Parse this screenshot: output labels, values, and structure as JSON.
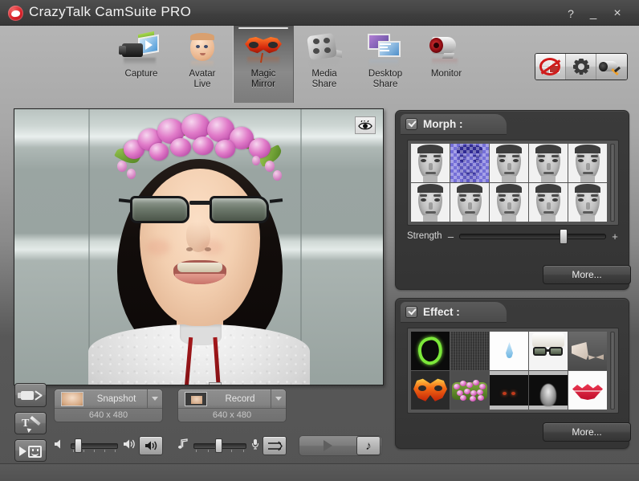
{
  "window": {
    "title": "CrazyTalk CamSuite PRO",
    "logo_icon": "crazytalk-lips-logo",
    "help_label": "?",
    "minimize_label": "_",
    "close_label": "×"
  },
  "toolbar": {
    "items": [
      {
        "label": "Capture",
        "icon": "camera-capture-icon",
        "active": false
      },
      {
        "label": "Avatar\nLive",
        "icon": "avatar-face-icon",
        "active": false
      },
      {
        "label": "Magic\nMirror",
        "icon": "carnival-mask-icon",
        "active": true
      },
      {
        "label": "Media\nShare",
        "icon": "film-reel-icon",
        "active": false
      },
      {
        "label": "Desktop\nShare",
        "icon": "dual-monitor-icon",
        "active": false
      },
      {
        "label": "Monitor",
        "icon": "webcam-monitor-icon",
        "active": false
      }
    ],
    "right_buttons": [
      {
        "name": "disable-sharing-button",
        "icon": "no-share-icon",
        "active": true
      },
      {
        "name": "settings-button",
        "icon": "gear-icon",
        "active": false
      },
      {
        "name": "camera-setup-button",
        "icon": "camera-setup-icon",
        "active": false
      }
    ]
  },
  "preview": {
    "eye_toggle_icon": "eye-icon",
    "description": "Live webcam preview: smiling woman with black hair, white lace top and red lanyard, wearing applied sunglasses effect and purple flower-crown effect, in front of a gray wall with horizontal window frames."
  },
  "side_buttons": [
    {
      "name": "video-clip-button",
      "icon": "video-clip-icon"
    },
    {
      "name": "text-draw-button",
      "icon": "text-pen-icon"
    },
    {
      "name": "emoticon-button",
      "icon": "cursor-smiley-icon"
    }
  ],
  "capture": {
    "snapshot": {
      "label": "Snapshot",
      "resolution": "640 x 480",
      "thumb_icon": "snapshot-thumb-icon",
      "caret_icon": "chevron-down-icon"
    },
    "record": {
      "label": "Record",
      "resolution": "640 x 480",
      "thumb_icon": "record-thumb-icon",
      "caret_icon": "chevron-down-icon"
    }
  },
  "audio": {
    "volume": {
      "icon_low": "speaker-low-icon",
      "icon_high": "speaker-high-icon",
      "value_percent": 10,
      "mute_button_icon": "speaker-button-icon"
    },
    "music": {
      "icon_music": "music-note-icon",
      "icon_mic": "microphone-icon",
      "value_percent": 48,
      "mixer_button_icon": "audio-mixer-icon"
    }
  },
  "playback": {
    "play_icon": "play-triangle-icon",
    "music_icon": "music-note-icon"
  },
  "morph_panel": {
    "title": "Morph :",
    "enabled": true,
    "checkbox_icon": "checkbox-checked-icon",
    "thumbnails": [
      {
        "name": "morph-face-1",
        "selected": false
      },
      {
        "name": "morph-face-2",
        "selected": true
      },
      {
        "name": "morph-face-3",
        "selected": false
      },
      {
        "name": "morph-face-4",
        "selected": false
      },
      {
        "name": "morph-face-5",
        "selected": false
      },
      {
        "name": "morph-face-6",
        "selected": false
      },
      {
        "name": "morph-face-7",
        "selected": false
      },
      {
        "name": "morph-face-8",
        "selected": false
      },
      {
        "name": "morph-face-9",
        "selected": false
      },
      {
        "name": "morph-face-10",
        "selected": false
      }
    ],
    "strength": {
      "label": "Strength",
      "minus": "–",
      "plus": "+",
      "value_percent": 72
    },
    "more_label": "More..."
  },
  "effect_panel": {
    "title": "Effect :",
    "enabled": true,
    "checkbox_icon": "checkbox-checked-icon",
    "thumbnails": [
      {
        "name": "effect-neon-swirl",
        "style": "efx-neon",
        "selected": false
      },
      {
        "name": "effect-noise",
        "style": "efx-noise",
        "selected": false
      },
      {
        "name": "effect-water-drop",
        "style": "efx-drop",
        "selected": false
      },
      {
        "name": "effect-sunglasses",
        "style": "efx-glasses",
        "selected": true
      },
      {
        "name": "effect-twist",
        "style": "efx-twist",
        "selected": false
      },
      {
        "name": "effect-fire-mask",
        "style": "efx-fire",
        "selected": false
      },
      {
        "name": "effect-flower-crown",
        "style": "efx-flowers",
        "selected": true
      },
      {
        "name": "effect-dark-eyes",
        "style": "efx-dark",
        "selected": false
      },
      {
        "name": "effect-xray",
        "style": "efx-xray",
        "selected": false
      },
      {
        "name": "effect-red-lips",
        "style": "efx-lips",
        "selected": false
      }
    ],
    "more_label": "More..."
  },
  "colors": {
    "titlebar": "#3f3f3f",
    "window_body_light": "#b0b0b0",
    "window_body_dark": "#545454",
    "panel_bg": "#3a3a3a",
    "selection_red": "#e81313",
    "selection_blue": "#2a1ec8",
    "text_light": "#ececec",
    "text_dark": "#1d1d1d"
  }
}
